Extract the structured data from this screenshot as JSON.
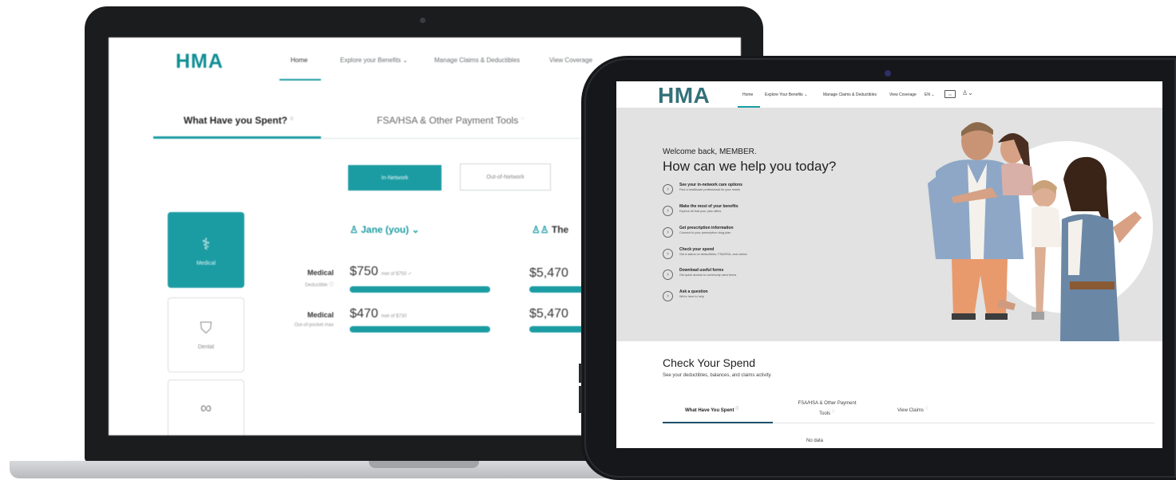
{
  "laptop": {
    "logo": "HMA",
    "nav": {
      "home": "Home",
      "explore": "Explore your Benefits ⌄",
      "manage": "Manage Claims & Deductibles",
      "coverage": "View Coverage"
    },
    "tabs": {
      "spent": "What Have you Spent?",
      "fsa": "FSA/HSA & Other Payment Tools"
    },
    "network": {
      "in": "In-Network",
      "out": "Out-of-Network"
    },
    "cards": {
      "medical": "Medical",
      "dental": "Dental"
    },
    "person": "Jane (you) ⌄",
    "person2": "The",
    "rows": [
      {
        "label": "Medical",
        "sub": "Deductible ⓘ",
        "amount": "$750",
        "amount_sub": "met of $750 ✓",
        "amount2": "$5,470"
      },
      {
        "label": "Medical",
        "sub": "Out-of-pocket max",
        "amount": "$470",
        "amount_sub": "met of $730",
        "amount2": "$5,470"
      }
    ]
  },
  "tablet": {
    "logo": "HMA",
    "nav": {
      "home": "Home",
      "explore": "Explore Your Benefits ⌄",
      "manage": "Manage Claims & Deductibles",
      "coverage": "View Coverage",
      "lang": "EN ⌄"
    },
    "welcome": "Welcome back, MEMBER.",
    "headline": "How can we help you today?",
    "items": [
      {
        "title": "See your in-network care options",
        "sub": "Find a healthcare professional for your needs"
      },
      {
        "title": "Make the most of your benefits",
        "sub": "Explore all that your plan offers"
      },
      {
        "title": "Get prescription information",
        "sub": "Connect to your prescription drug plan"
      },
      {
        "title": "Check your spend",
        "sub": "Get a status on deductibles, FSA/HSA, and claims"
      },
      {
        "title": "Download useful forms",
        "sub": "Get quick access to commonly used forms"
      },
      {
        "title": "Ask a question",
        "sub": "We're here to help"
      }
    ],
    "check_title": "Check Your Spend",
    "check_sub": "See your deductibles, balances, and claims activity.",
    "tabs": {
      "spent": "What Have You Spent",
      "fsa": "FSA/HSA & Other Payment Tools",
      "claims": "View Claims"
    },
    "no_data": "No data"
  },
  "colors": {
    "teal": "#1b9ca3",
    "logo_dark": "#34717a",
    "hero_bg": "#e1e2e1"
  }
}
